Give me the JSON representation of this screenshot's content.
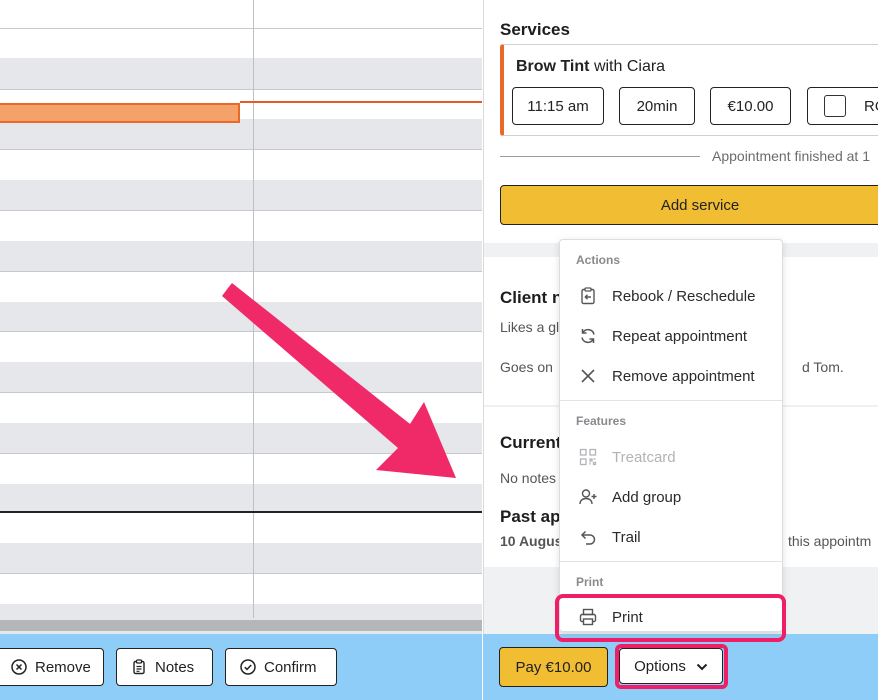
{
  "services": {
    "title": "Services",
    "service_name": "Brow Tint",
    "service_with": "with Ciara",
    "time": "11:15 am",
    "duration": "20min",
    "price": "€10.00",
    "checkbox_label": "RO",
    "finished_text": "Appointment finished at 1",
    "add_service_label": "Add service"
  },
  "client_notes": {
    "title": "Client n",
    "line1": "Likes a gl",
    "line2": "Goes on",
    "line2_tail": "d Tom."
  },
  "current_notes": {
    "title": "Current",
    "empty": "No notes"
  },
  "past": {
    "title": "Past app",
    "date": "10 August",
    "tail": "this appointm"
  },
  "menu": {
    "actions_label": "Actions",
    "rebook": "Rebook / Reschedule",
    "repeat": "Repeat appointment",
    "remove": "Remove appointment",
    "features_label": "Features",
    "treatcard": "Treatcard",
    "add_group": "Add group",
    "trail": "Trail",
    "print_label": "Print",
    "print": "Print"
  },
  "left_footer": {
    "remove": "Remove",
    "notes": "Notes",
    "confirm": "Confirm"
  },
  "right_footer": {
    "pay": "Pay €10.00",
    "options": "Options"
  },
  "colors": {
    "accent_yellow": "#f1bd33",
    "footer_blue": "#8ecdf7",
    "event_orange": "#f5a26a",
    "highlight_pink": "#ee1f66"
  }
}
